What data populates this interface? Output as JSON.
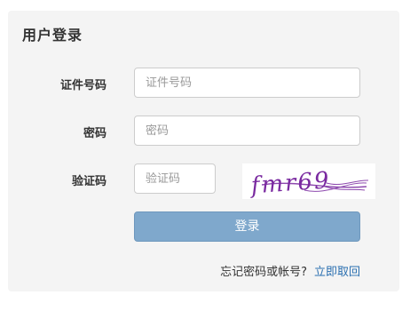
{
  "panel": {
    "title": "用户登录"
  },
  "form": {
    "id_label": "证件号码",
    "id_placeholder": "证件号码",
    "id_value": "",
    "password_label": "密码",
    "password_placeholder": "密码",
    "password_value": "",
    "captcha_label": "验证码",
    "captcha_placeholder": "验证码",
    "captcha_value": "",
    "captcha_image_text": "fmr69",
    "captcha_image_color": "#7a2aa0",
    "login_label": "登录",
    "login_color": "#7fa8cc"
  },
  "footer": {
    "question": "忘记密码或帐号?",
    "recover_link": "立即取回",
    "link_color": "#2a6fb0"
  }
}
